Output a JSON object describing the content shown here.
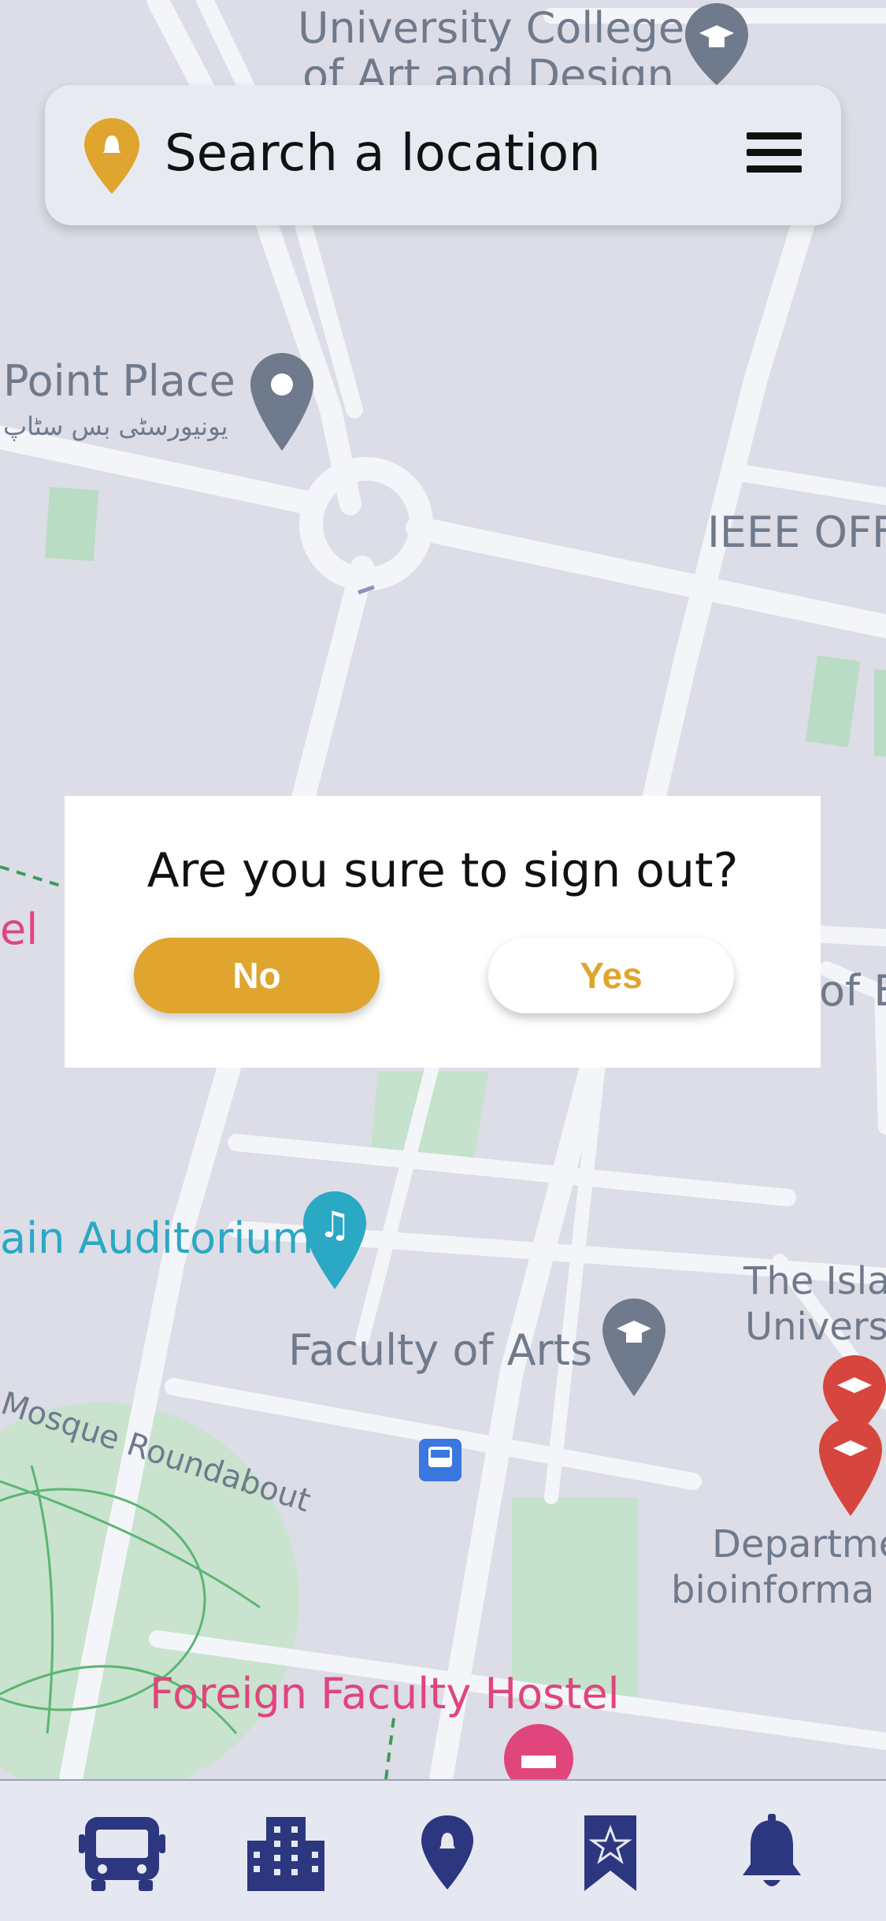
{
  "map": {
    "labels": {
      "ucad_line1": "University College",
      "ucad_line2": "of Art and Design",
      "point_place": "Point Place",
      "point_place_urdu": "یونیورسٹی بس سٹاپ",
      "ieee": "IEEE OFF",
      "hostel_fragment": "el",
      "of_e_fragment": "of E",
      "main_auditorium": "ain Auditorium",
      "faculty_arts": "Faculty of Arts",
      "islamia_line1": "The Isla",
      "islamia_line2": "Univers",
      "mosque_roundabout": "Mosque Roundabout",
      "dept_line1": "Departme",
      "dept_line2": "bioinforma",
      "foreign_hostel": "Foreign Faculty Hostel"
    },
    "colors": {
      "background": "#dcdde6",
      "road": "#f4f5f9",
      "park": "#b9dcc4",
      "label_gray": "#6f7a8c",
      "label_teal": "#2aa8c4",
      "label_pink": "#e0457b"
    }
  },
  "search": {
    "placeholder": "Search a location",
    "pin_icon": "location-pin-icon",
    "menu_icon": "hamburger-menu-icon"
  },
  "dialog": {
    "title": "Are you sure to sign out?",
    "no_label": "No",
    "yes_label": "Yes"
  },
  "bottom_nav": {
    "items": [
      {
        "name": "bus",
        "icon": "bus-icon"
      },
      {
        "name": "buildings",
        "icon": "buildings-icon"
      },
      {
        "name": "location",
        "icon": "location-pin-icon"
      },
      {
        "name": "bookmarks",
        "icon": "bookmark-star-icon"
      },
      {
        "name": "notifications",
        "icon": "bell-icon"
      }
    ]
  },
  "colors": {
    "accent": "#dfa52e",
    "nav_icon": "#2c3780",
    "nav_bg": "#e6e8f1"
  }
}
